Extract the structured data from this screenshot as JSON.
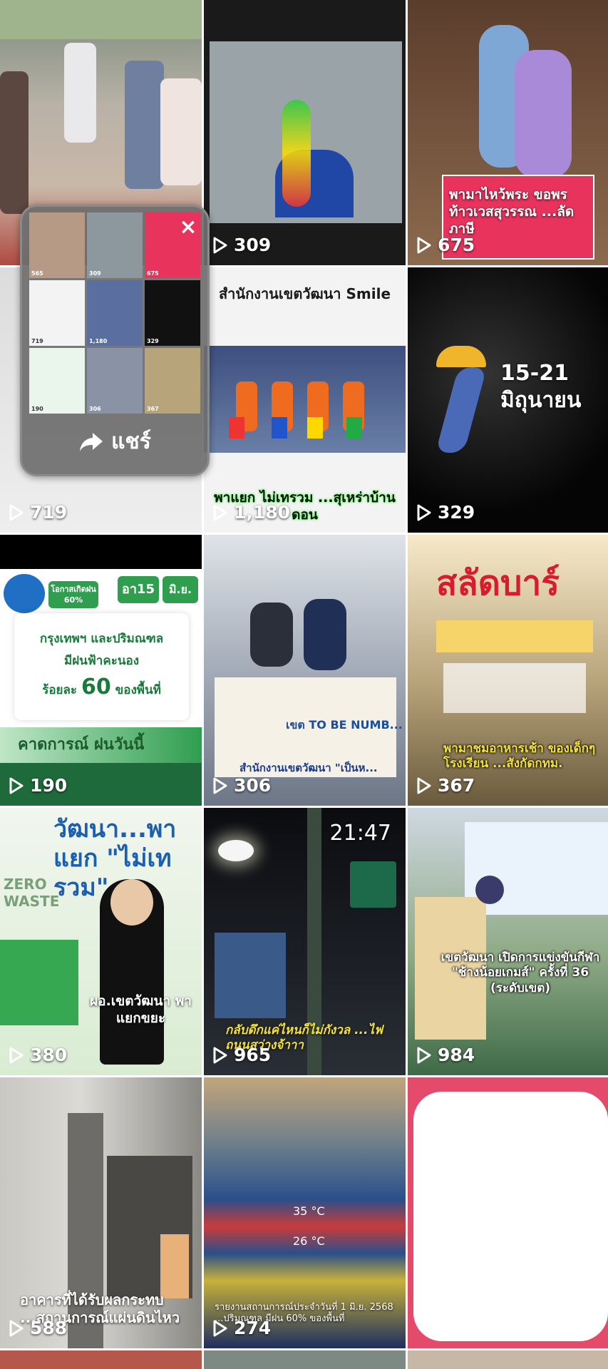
{
  "tiles": [
    {
      "views": "309",
      "caption": ""
    },
    {
      "views": "675",
      "caption": "พามาไหว้พระ ขอพรท้าวเวสสุวรรณ ...ลัดภาษี"
    },
    {
      "views": "719",
      "caption": ""
    },
    {
      "views": "1,180",
      "caption": "พาแยก ไม่เทรวม ...สุเหร่าบ้านดอน",
      "header": "สำนักงานเขตวัฒนา Smile"
    },
    {
      "views": "329",
      "caption": "",
      "header": "15-21 มิถุนายน"
    },
    {
      "views": "190",
      "caption": "",
      "badge": "โอกาสเกิดฝน 60%",
      "date_a": "อา15",
      "date_b": "มิ.ย.",
      "body1": "กรุงเทพฯ และปริมณฑล",
      "body2": "มีฝนฟ้าคะนอง",
      "body3": "ร้อยละ",
      "body_num": "60",
      "body4": "ของพื้นที่",
      "footer": "คาดการณ์ ฝนวันนี้"
    },
    {
      "views": "306",
      "caption": "สำนักงานเขตวัฒนา \"เป็นห...",
      "sign": "เขต TO BE NUMB..."
    },
    {
      "views": "367",
      "caption": "พามาชมอาหารเช้า ของเด็กๆโรงเรียน ...สังกัดกทม.",
      "header": "สลัดบาร์"
    },
    {
      "views": "380",
      "caption": "ผอ.เขตวัฒนา พาแยกขยะ",
      "header": "วัฒนา...พาแยก \"ไม่เทรวม\"",
      "zero": "ZERO WASTE"
    },
    {
      "views": "965",
      "caption": "กลับดึกแค่ไหนก็ไม่กังวล ...ไฟถนนสว่างจ้าาา",
      "time": "21:47"
    },
    {
      "views": "984",
      "caption": "เขตวัฒนา เปิดการแข่งขันกีฬา \"ช้างน้อยเกมส์\" ครั้งที่ 36 (ระดับเขต)"
    },
    {
      "views": "588",
      "caption": "อาคารที่ได้รับผลกระทบ ...สถานการณ์แผ่นดินไหว"
    },
    {
      "views": "274",
      "caption": "รายงานสถานการณ์ประจำวันที่ 1 มิ.ย. 2568 ...ปริมณฑล มีฝน 60% ของพื้นที่",
      "temp1": "35 °C",
      "temp2": "26 °C"
    }
  ],
  "share_popup": {
    "share_label": "แชร์",
    "mini_views": [
      "565",
      "309",
      "675",
      "719",
      "1,180",
      "329",
      "190",
      "306",
      "367"
    ]
  },
  "colors": {
    "accent_pink": "#e8335d",
    "accent_green": "#2f9e4f",
    "popup_bg": "#6e6e6e"
  }
}
